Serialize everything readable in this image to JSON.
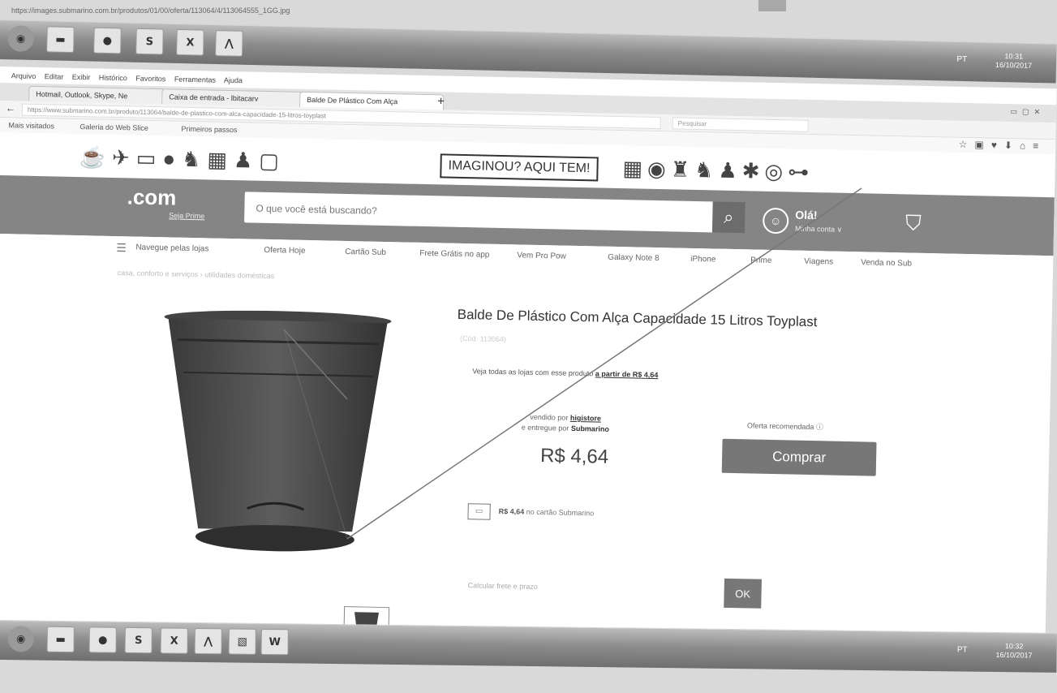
{
  "top": {
    "url_text": "https://images.submarino.com.br/produtos/01/00/oferta/113064/4/113064555_1GG.jpg"
  },
  "taskbar": {
    "top_clock": "10:31\n16/10/2017",
    "bottom_clock": "10:32\n16/10/2017",
    "tray_lang": "PT",
    "icons": [
      "start",
      "explorer",
      "chrome",
      "skype",
      "excel",
      "acrobat",
      "word"
    ]
  },
  "browser": {
    "menu": [
      "Arquivo",
      "Editar",
      "Exibir",
      "Histórico",
      "Favoritos",
      "Ferramentas",
      "Ajuda"
    ],
    "tabs": [
      "Hotmail, Outlook, Skype, Ne",
      "Caixa de entrada - lbitacarv",
      "Balde De Plástico Com Alça"
    ],
    "url": "https://www.submarino.com.br/produto/113064/balde-de-plastico-com-alca-capacidade-15-litros-toyplast",
    "search_placeholder": "Pesquisar",
    "bookmarks": [
      "Mais visitados",
      "Galeria do Web Slice",
      "Primeiros passos"
    ]
  },
  "banner": {
    "cta": "IMAGINOU? AQUI TEM!"
  },
  "header": {
    "logo": ".com",
    "logo_sub": "Seja Prime",
    "search_placeholder": "O que você está buscando?",
    "greeting": "Olá!",
    "account": "Minha conta ∨"
  },
  "nav": {
    "items": [
      "Navegue pelas lojas",
      "Oferta Hoje",
      "Cartão Sub",
      "Frete Grátis no app",
      "Vem Pro Pow",
      "Galaxy Note 8",
      "iPhone",
      "Prime",
      "Viagens",
      "Venda no Sub"
    ]
  },
  "breadcrumb": "casa, conforto e serviços › utilidades domésticas",
  "product": {
    "title": "Balde De Plástico Com Alça Capacidade 15 Litros Toyplast",
    "code": "(Cód. 113064)",
    "all_stores_text": "Veja todas as lojas com esse produto",
    "all_stores_link": "a partir de R$ 4,64",
    "sold_by_label": "vendido por",
    "seller": "higistore",
    "delivered_label": "e entregue por",
    "deliverer": "Submarino",
    "price": "R$ 4,64",
    "recommended": "Oferta recomendada ⓘ",
    "buy_button": "Comprar",
    "card_price": "R$ 4,64",
    "card_text": "no cartão Submarino",
    "shipping_label": "Calcular frete e prazo",
    "ok_button": "OK"
  }
}
